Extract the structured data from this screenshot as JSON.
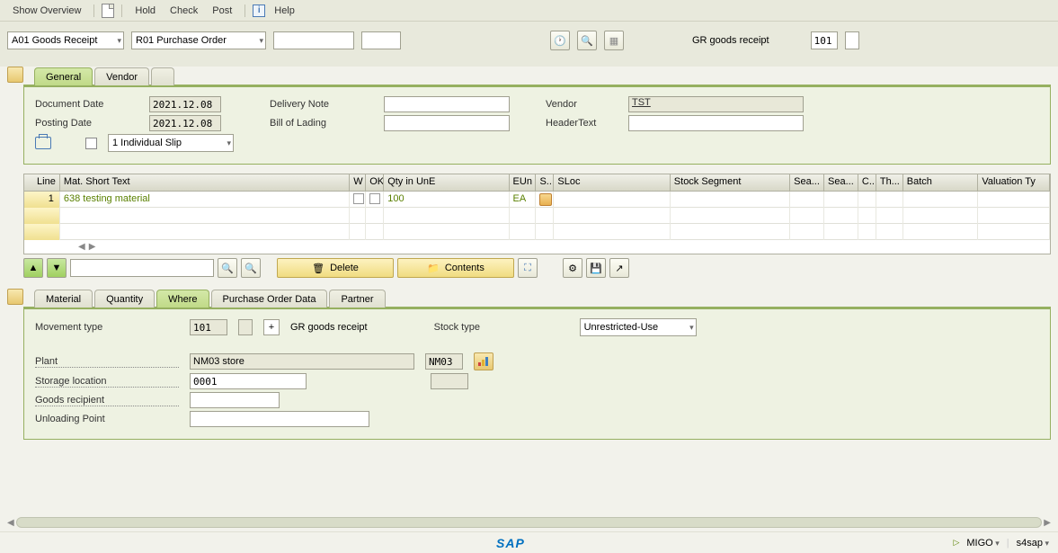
{
  "toolbar": {
    "show_overview": "Show Overview",
    "hold": "Hold",
    "check": "Check",
    "post": "Post",
    "help": "Help"
  },
  "selectors": {
    "action": "A01 Goods Receipt",
    "ref": "R01 Purchase Order",
    "gr_label": "GR goods receipt",
    "gr_code": "101"
  },
  "header_tabs": {
    "general": "General",
    "vendor": "Vendor"
  },
  "header": {
    "doc_date_lbl": "Document Date",
    "doc_date": "2021.12.08",
    "post_date_lbl": "Posting Date",
    "post_date": "2021.12.08",
    "slip": "1 Individual Slip",
    "delivery_note_lbl": "Delivery Note",
    "bill_lading_lbl": "Bill of Lading",
    "vendor_lbl": "Vendor",
    "vendor_val": "TST",
    "header_text_lbl": "HeaderText"
  },
  "grid": {
    "cols": {
      "line": "Line",
      "mat": "Mat. Short Text",
      "w": "W",
      "ok": "OK",
      "qty": "Qty in UnE",
      "eun": "EUn",
      "s": "S..",
      "sloc": "SLoc",
      "sseg": "Stock Segment",
      "sea1": "Sea...",
      "sea2": "Sea...",
      "c": "C...",
      "th": "Th...",
      "batch": "Batch",
      "vt": "Valuation Ty"
    },
    "rows": [
      {
        "line": "1",
        "mat": "638 testing material",
        "qty": "100",
        "eun": "EA"
      }
    ]
  },
  "mid": {
    "delete": "Delete",
    "contents": "Contents"
  },
  "detail_tabs": {
    "material": "Material",
    "quantity": "Quantity",
    "where": "Where",
    "po_data": "Purchase Order Data",
    "partner": "Partner"
  },
  "where": {
    "mvt_lbl": "Movement type",
    "mvt_code": "101",
    "mvt_desc": "GR goods receipt",
    "stock_type_lbl": "Stock type",
    "stock_type_val": "Unrestricted-Use",
    "plant_lbl": "Plant",
    "plant_name": "NM03 store",
    "plant_code": "NM03",
    "sloc_lbl": "Storage location",
    "sloc_val": "0001",
    "goods_rcp_lbl": "Goods recipient",
    "unload_lbl": "Unloading Point"
  },
  "footer": {
    "sap": "SAP",
    "tcode": "MIGO",
    "system": "s4sap"
  }
}
